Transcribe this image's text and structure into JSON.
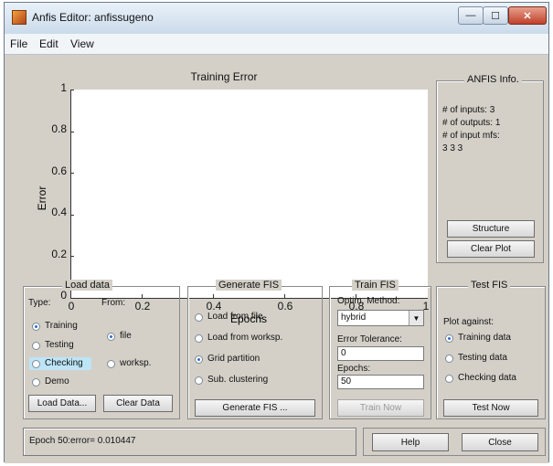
{
  "window": {
    "title": "Anfis Editor: anfissugeno",
    "min_glyph": "—",
    "max_glyph": "☐",
    "close_glyph": "✕"
  },
  "menu": [
    "File",
    "Edit",
    "View"
  ],
  "plot": {
    "title": "Training Error",
    "xlabel": "Epochs",
    "ylabel": "Error",
    "yticks": [
      "1",
      "0.8",
      "0.6",
      "0.4",
      "0.2",
      "0"
    ],
    "xticks": [
      "0",
      "0.2",
      "0.4",
      "0.6",
      "0.8",
      "1"
    ]
  },
  "anfis_info": {
    "title": "ANFIS Info.",
    "lines": [
      "# of inputs: 3",
      "# of outputs: 1",
      "# of input mfs:",
      "3  3  3"
    ],
    "structure_button": "Structure",
    "clear_plot_button": "Clear Plot"
  },
  "load_data": {
    "title": "Load data",
    "type_label": "Type:",
    "from_label": "From:",
    "types": [
      "Training",
      "Testing",
      "Checking",
      "Demo"
    ],
    "froms": [
      "file",
      "worksp."
    ],
    "load_button": "Load Data...",
    "clear_button": "Clear Data"
  },
  "generate_fis": {
    "title": "Generate FIS",
    "options": [
      "Load from file",
      "Load from worksp.",
      "Grid partition",
      "Sub. clustering"
    ],
    "button": "Generate FIS ..."
  },
  "train_fis": {
    "title": "Train FIS",
    "optim_label": "Optim. Method:",
    "method": "hybrid",
    "tolerance_label": "Error Tolerance:",
    "tolerance": "0",
    "epochs_label": "Epochs:",
    "epochs": "50",
    "button": "Train Now"
  },
  "test_fis": {
    "title": "Test FIS",
    "plot_against": "Plot against:",
    "options": [
      "Training data",
      "Testing data",
      "Checking data"
    ],
    "button": "Test Now"
  },
  "status_text": "Epoch 50:error= 0.010447",
  "help_button": "Help",
  "close_button": "Close"
}
